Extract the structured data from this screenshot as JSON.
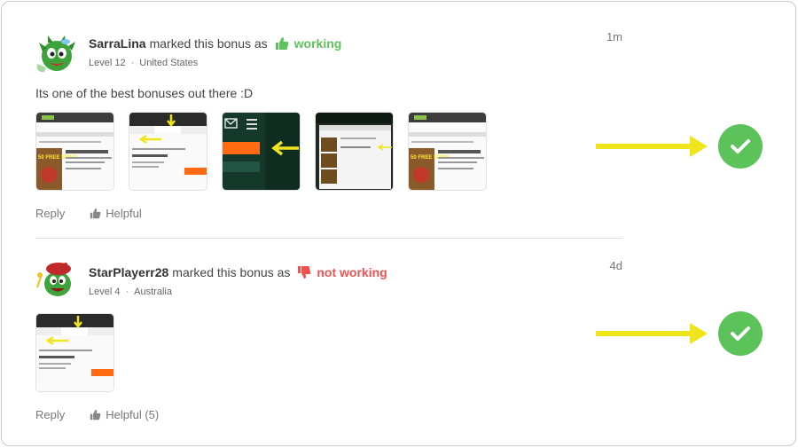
{
  "comments": [
    {
      "username": "SarraLina",
      "action_text": "marked this bonus as",
      "status_label": "working",
      "status_type": "working",
      "level": "Level 12",
      "country": "United States",
      "time": "1m",
      "text": "Its one of the best bonuses out there :D",
      "reply_label": "Reply",
      "helpful_label": "Helpful",
      "thumbnails": [
        "screenshot-1",
        "screenshot-2",
        "screenshot-3",
        "screenshot-4",
        "screenshot-5"
      ]
    },
    {
      "username": "StarPlayerr28",
      "action_text": "marked this bonus as",
      "status_label": "not working",
      "status_type": "not-working",
      "level": "Level 4",
      "country": "Australia",
      "time": "4d",
      "text": "",
      "reply_label": "Reply",
      "helpful_label": "Helpful (5)",
      "thumbnails": [
        "screenshot-1"
      ]
    }
  ],
  "annotations": [
    {
      "icon": "arrow-right-icon",
      "color": "#f0e51a"
    },
    {
      "icon": "check-circle-icon",
      "color": "#5cc35a"
    }
  ],
  "colors": {
    "working": "#5cc35a",
    "not_working": "#ef5350",
    "arrow": "#f0e51a"
  }
}
